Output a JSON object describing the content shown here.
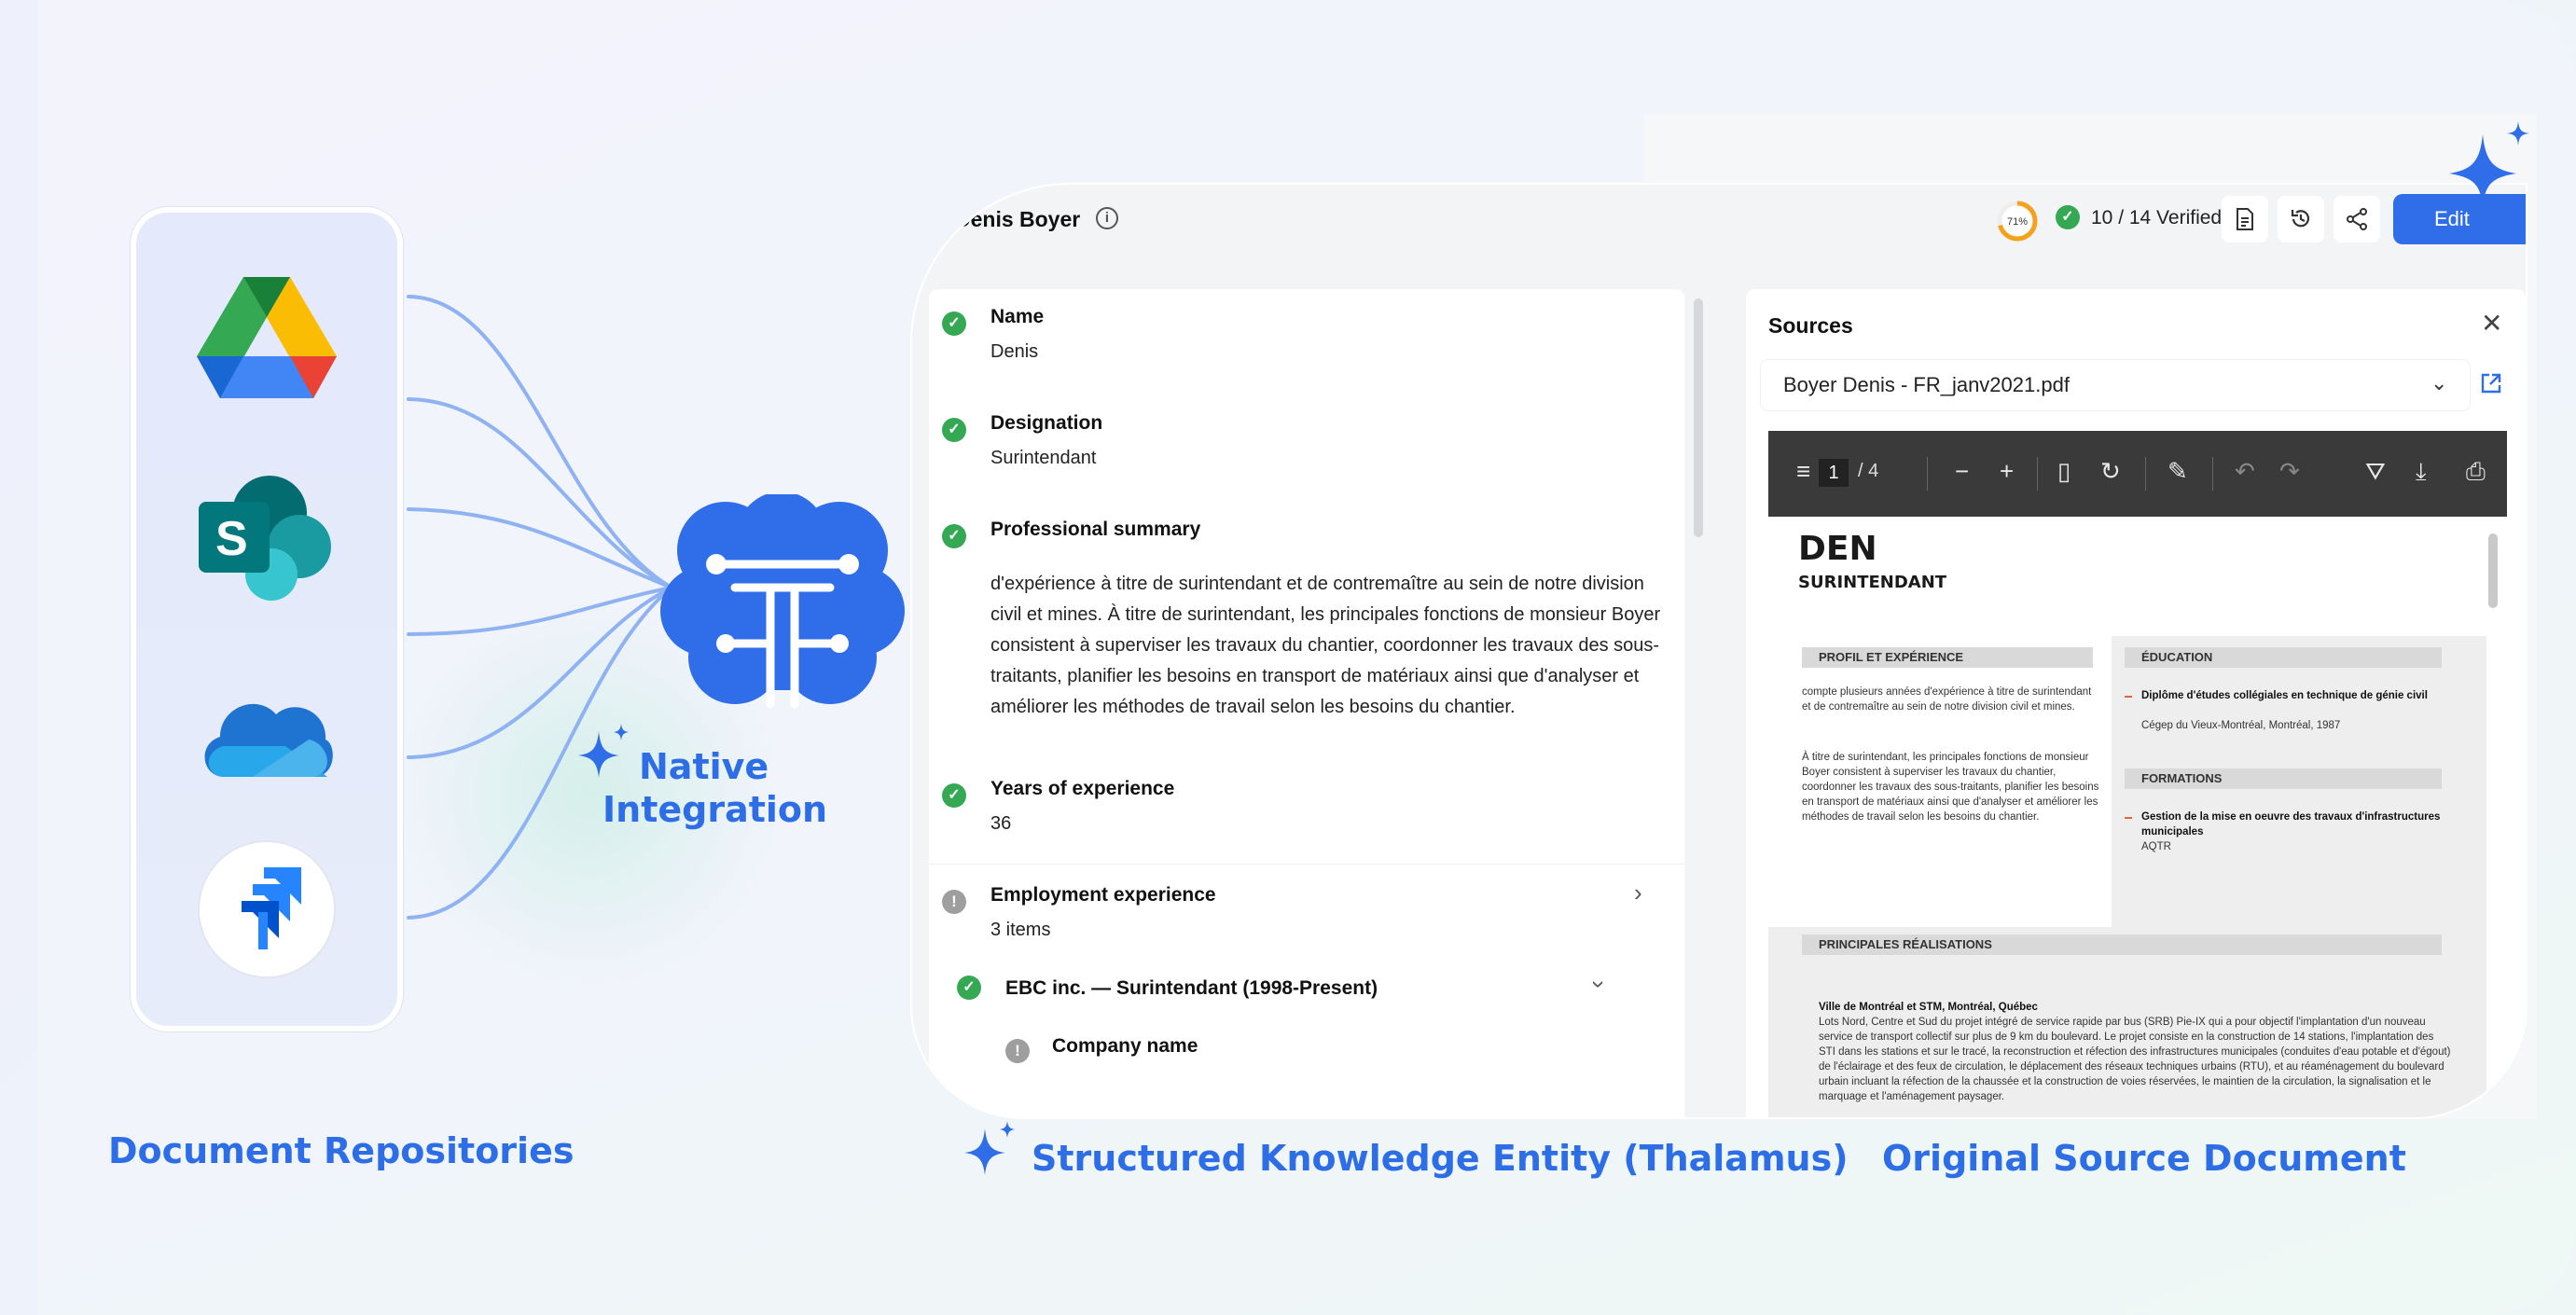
{
  "labels": {
    "repositories": "Document Repositories",
    "native_integration_line1": "Native",
    "native_integration_line2": "Integration",
    "entity": "Structured Knowledge Entity (Thalamus)",
    "source": "Original Source Document"
  },
  "repositories": [
    {
      "name": "google-drive-icon"
    },
    {
      "name": "sharepoint-icon",
      "letter": "S"
    },
    {
      "name": "onedrive-icon"
    },
    {
      "name": "jira-icon"
    }
  ],
  "header": {
    "person_name": "Denis Boyer",
    "info_icon": "i",
    "progress_percent": 71,
    "progress_label": "71%",
    "verified": "10 / 14 Verified",
    "edit_label": "Edit"
  },
  "entity": {
    "fields": [
      {
        "label": "Name",
        "value": "Denis",
        "status": "verified"
      },
      {
        "label": "Designation",
        "value": "Surintendant",
        "status": "verified"
      },
      {
        "label": "Professional summary",
        "value": "d'expérience à titre de surintendant et de contremaître au sein de notre division civil et mines. À titre de surintendant, les principales fonctions de monsieur Boyer consistent à superviser les travaux du chantier, coordonner les travaux des sous-traitants, planifier les besoins en transport de matériaux ainsi que d'analyser et améliorer les méthodes de travail selon les besoins du chantier.",
        "status": "verified"
      },
      {
        "label": "Years of experience",
        "value": "36",
        "status": "verified"
      },
      {
        "label": "Employment experience",
        "value": "3 items",
        "status": "warning"
      }
    ],
    "employment_item": "EBC inc. — Surintendant (1998-Present)",
    "sub_field": "Company name"
  },
  "sources": {
    "title": "Sources",
    "close": "✕",
    "file_name": "Boyer Denis - FR_janv2021.pdf",
    "pdf": {
      "current_page": "1",
      "total_pages": "/ 4"
    },
    "document": {
      "name": "DEN",
      "role": "SURINTENDANT",
      "section_profile": "PROFIL ET EXPÉRIENCE",
      "profile_p1": "compte plusieurs années d'expérience à titre de surintendant et de contremaître au sein de notre division civil et mines.",
      "profile_p2": "À titre de surintendant, les principales fonctions de monsieur Boyer consistent à superviser les travaux du chantier, coordonner les travaux des sous-traitants, planifier les besoins en transport de matériaux ainsi que d'analyser et améliorer les méthodes de travail selon les besoins du chantier.",
      "section_education": "ÉDUCATION",
      "edu_title": "Diplôme d'études collégiales en technique de génie civil",
      "edu_school": "Cégep du Vieux-Montréal, Montréal, 1987",
      "section_training": "FORMATIONS",
      "training_title": "Gestion de la mise en oeuvre des travaux d'infrastructures municipales",
      "training_org": "AQTR",
      "section_achievements": "PRINCIPALES RÉALISATIONS",
      "achievement_title": "Ville de Montréal et STM, Montréal, Québec",
      "achievement_text": "Lots Nord, Centre et Sud du projet intégré de service rapide par bus (SRB) Pie-IX qui a pour objectif l'implantation d'un nouveau service de transport collectif sur plus de 9 km du boulevard. Le projet consiste en la construction de 14 stations, l'implantation des STI dans les stations et sur le tracé, la reconstruction et réfection des infrastructures municipales (conduites d'eau potable et d'égout) de l'éclairage et des feux de circulation, le déplacement des réseaux techniques urbains (RTU), et au réaménagement du boulevard urbain incluant la réfection de la chaussée et la construction de voies réservées, le maintien de la circulation, la signalisation et le marquage et l'aménagement paysager."
    }
  },
  "colors": {
    "accent": "#2f6ee8",
    "label_blue": "#2d6ee6",
    "verified_green": "#34a853",
    "warning_gray": "#9e9e9e",
    "progress_orange": "#f4a11b"
  }
}
